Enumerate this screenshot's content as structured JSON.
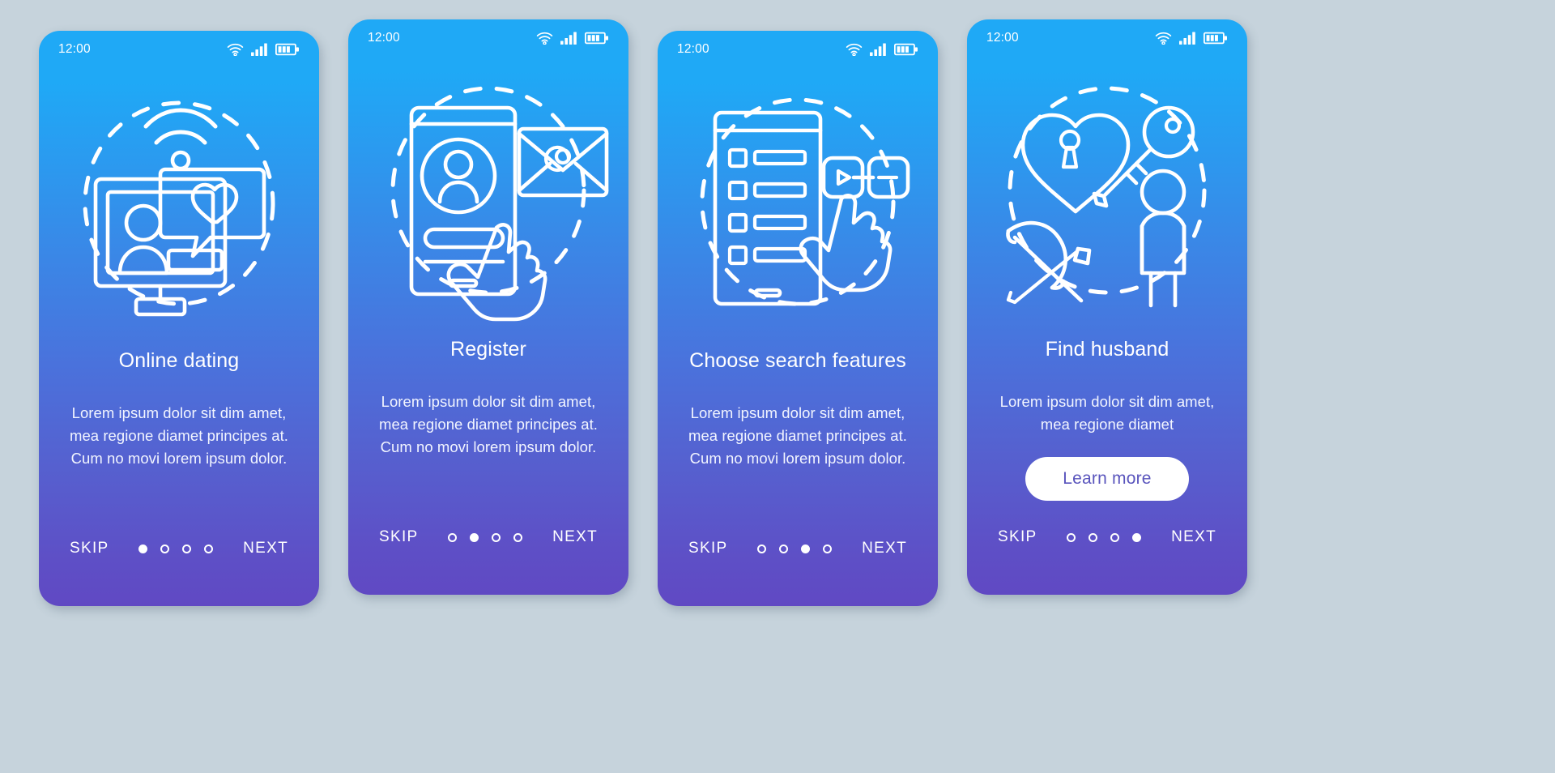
{
  "page": {
    "background_color": "#c6d3dc",
    "card_gradient_top": "#1fa9f6",
    "card_gradient_bottom": "#6049c3",
    "accent_text_color": "#5a55bd"
  },
  "status_bar": {
    "time": "12:00",
    "icons": [
      "wifi-icon",
      "cellular-signal-icon",
      "battery-icon"
    ]
  },
  "screens": [
    {
      "id": "online-dating",
      "illustration": "monitor-profile-heart-chat-wifi-icon",
      "title": "Online dating",
      "body": "Lorem ipsum dolor sit dim amet, mea regione diamet principes at. Cum no movi lorem ipsum dolor.",
      "cta": null,
      "skip_label": "SKIP",
      "next_label": "NEXT",
      "dots": 4,
      "active_dot": 1
    },
    {
      "id": "register",
      "illustration": "smartphone-profile-hand-envelope-at-icon",
      "title": "Register",
      "body": "Lorem ipsum dolor sit dim amet, mea regione diamet principes at. Cum no movi lorem ipsum dolor.",
      "cta": null,
      "skip_label": "SKIP",
      "next_label": "NEXT",
      "dots": 4,
      "active_dot": 2
    },
    {
      "id": "choose-search-features",
      "illustration": "tablet-checklist-hand-toggle-icon",
      "title": "Choose search features",
      "body": "Lorem ipsum dolor sit dim amet, mea regione diamet principes at. Cum no movi lorem ipsum dolor.",
      "cta": null,
      "skip_label": "SKIP",
      "next_label": "NEXT",
      "dots": 4,
      "active_dot": 3
    },
    {
      "id": "find-husband",
      "illustration": "heart-lock-key-bow-arrow-person-icon",
      "title": "Find husband",
      "body": "Lorem ipsum dolor sit dim amet, mea regione diamet",
      "cta": "Learn more",
      "skip_label": "SKIP",
      "next_label": "NEXT",
      "dots": 4,
      "active_dot": 4
    }
  ]
}
